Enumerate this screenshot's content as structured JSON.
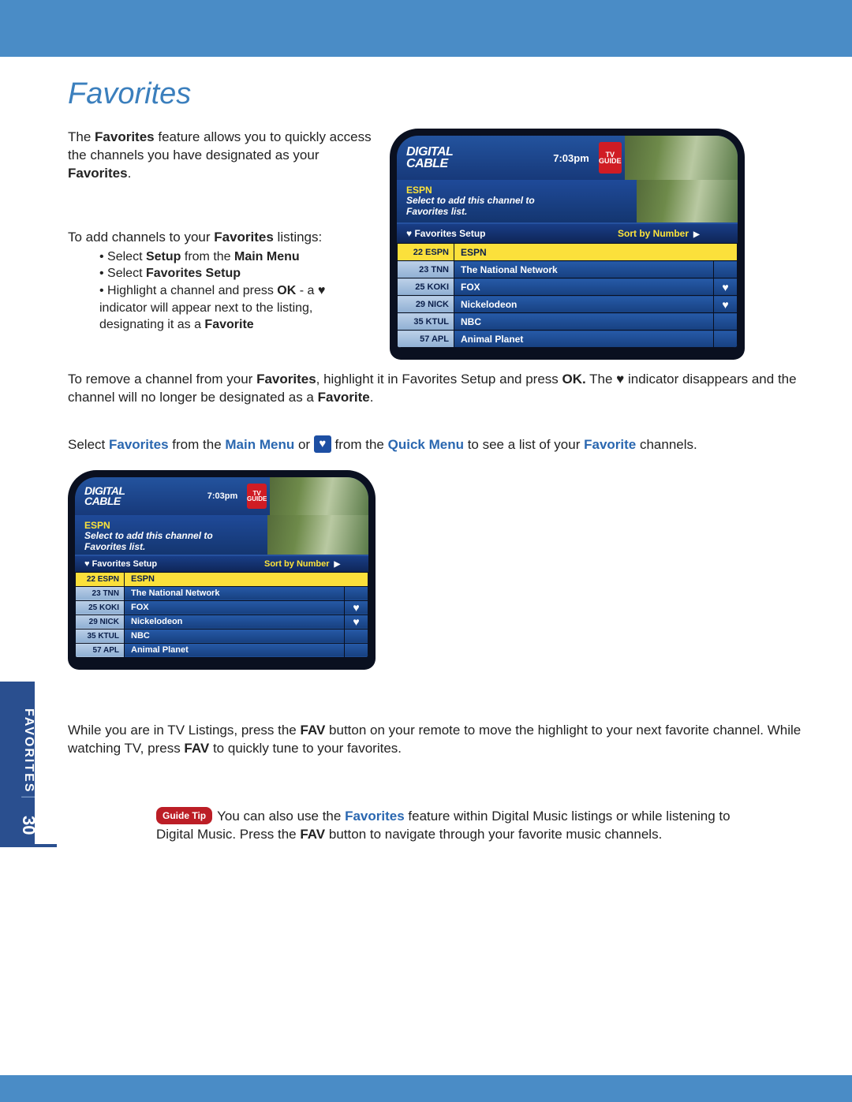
{
  "page": {
    "title": "Favorites",
    "side_label": "FAVORITES",
    "page_number": "30"
  },
  "intro": {
    "line1a": "The ",
    "line1b": "Favorites",
    "line1c": " feature allows you to quickly access the channels you have designated as your ",
    "line1d": "Favorites",
    "line1e": "."
  },
  "add": {
    "lead_a": "To add channels to your ",
    "lead_b": "Favorites",
    "lead_c": " listings:",
    "b1_a": "Select ",
    "b1_b": "Setup",
    "b1_c": " from the ",
    "b1_d": "Main Menu",
    "b2_a": "Select ",
    "b2_b": "Favorites Setup",
    "b3_a": "Highlight a channel and press ",
    "b3_b": "OK",
    "b3_c": " - a ",
    "b3_d": " indicator will appear next to the listing, designating it as a ",
    "b3_e": "Favorite"
  },
  "remove": {
    "a": "To remove a channel from your ",
    "b": "Favorites",
    "c": ", highlight it in Favorites Setup and press ",
    "d": "OK.",
    "e": "  The ",
    "f": " indicator disappears and the channel will no longer be designated as a ",
    "g": "Favorite",
    "h": "."
  },
  "select_line": {
    "a": "Select ",
    "b": "Favorites",
    "c": " from the ",
    "d": "Main Menu",
    "e": " or ",
    "f": " from the ",
    "g": "Quick Menu",
    "h": " to see a list of your ",
    "i": "Favorite",
    "j": " channels."
  },
  "fav_para": {
    "a": "While you are in TV Listings, press the ",
    "b": "FAV",
    "c": " button on your remote to move the highlight to your next favorite channel. While watching TV, press ",
    "d": "FAV",
    "e": " to quickly tune to your favorites."
  },
  "tip": {
    "label": "Guide Tip",
    "a": "You can also use the ",
    "b": "Favorites",
    "c": " feature within Digital Music listings or while listening to Digital Music. Press the ",
    "d": "FAV",
    "e": " button to navigate through your favorite music channels."
  },
  "screenshot": {
    "logo_top": "DIGITAL",
    "logo_bot": "CABLE",
    "time": "7:03pm",
    "tvg_top": "TV",
    "tvg_bot": "GUIDE",
    "channel": "ESPN",
    "desc1": "Select to add this channel to",
    "desc2": "Favorites list.",
    "sub_left": "♥   Favorites Setup",
    "sub_right": "Sort by Number",
    "rows": [
      {
        "num": "22 ESPN",
        "name": "ESPN",
        "fav": false,
        "sel": true
      },
      {
        "num": "23 TNN",
        "name": "The National Network",
        "fav": false,
        "sel": false
      },
      {
        "num": "25 KOKI",
        "name": "FOX",
        "fav": true,
        "sel": false
      },
      {
        "num": "29 NICK",
        "name": "Nickelodeon",
        "fav": true,
        "sel": false
      },
      {
        "num": "35 KTUL",
        "name": "NBC",
        "fav": false,
        "sel": false
      },
      {
        "num": "57 APL",
        "name": "Animal Planet",
        "fav": false,
        "sel": false
      }
    ]
  }
}
